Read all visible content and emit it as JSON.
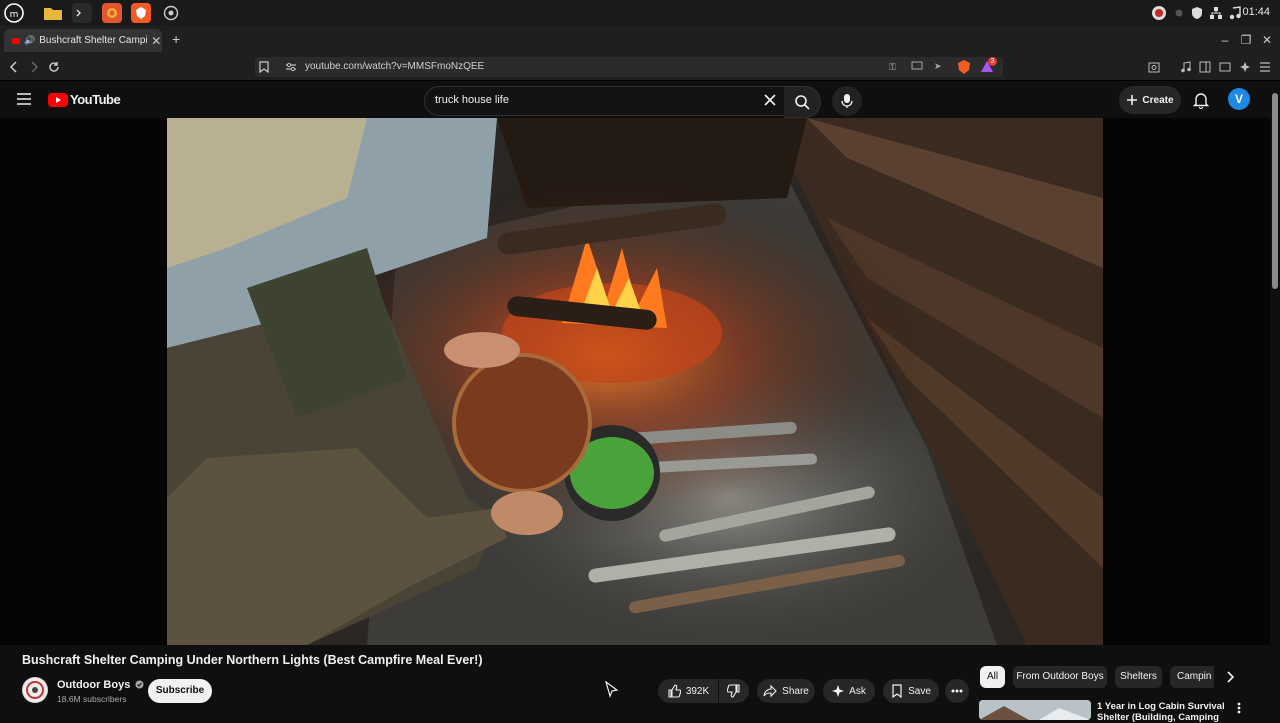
{
  "taskbar": {
    "apps": [
      "mint-menu-icon",
      "files-icon",
      "terminal-icon",
      "firefox-icon",
      "brave-icon",
      "extra-app-icon"
    ],
    "clock": "01:44"
  },
  "browser": {
    "tab_title": "Bushcraft Shelter Camping",
    "new_tab": "+",
    "url": "youtube.com/watch?v=MMSFmoNzQEE",
    "shield_badge": "3"
  },
  "youtube": {
    "logo_text": "YouTube",
    "search_value": "truck house life",
    "create_label": "Create",
    "avatar_letter": "V"
  },
  "video": {
    "title": "Bushcraft Shelter Camping Under Northern Lights (Best Campfire Meal Ever!)",
    "channel": "Outdoor Boys",
    "subscribers": "18.6M subscribers",
    "subscribe_label": "Subscribe",
    "likes": "392K",
    "share_label": "Share",
    "ask_label": "Ask",
    "save_label": "Save"
  },
  "chips": [
    "All",
    "From Outdoor Boys",
    "Shelters",
    "Campin"
  ],
  "recommendation": {
    "title": "1 Year in Log Cabin Survival Shelter (Building, Camping"
  },
  "colors": {
    "yt_red": "#ff0000",
    "background": "#0f0f0f",
    "avatar_blue": "#1e88e5"
  }
}
